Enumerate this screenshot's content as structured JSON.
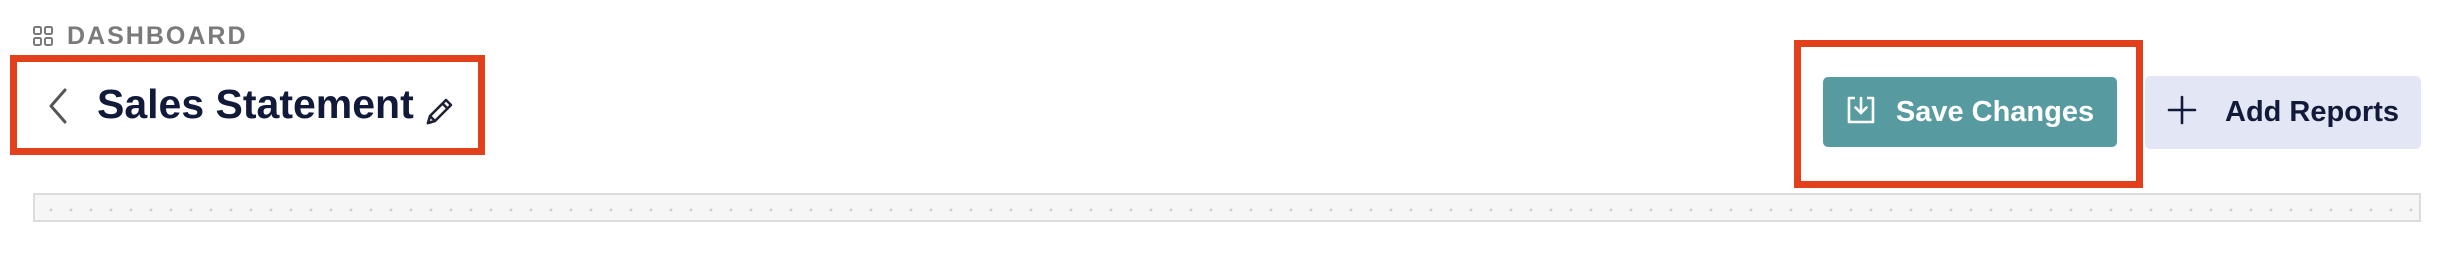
{
  "breadcrumb": {
    "icon": "grid-icon",
    "label": "DASHBOARD"
  },
  "header": {
    "back_icon": "chevron-left-icon",
    "title": "Sales Statement",
    "edit_icon": "pencil-icon"
  },
  "actions": {
    "save": {
      "label": "Save Changes",
      "icon": "save-download-icon",
      "color": "#579ba1"
    },
    "add_reports": {
      "label": "Add Reports",
      "icon": "plus-icon",
      "color": "#e3e6f4"
    }
  },
  "highlight_color": "#e2401c"
}
